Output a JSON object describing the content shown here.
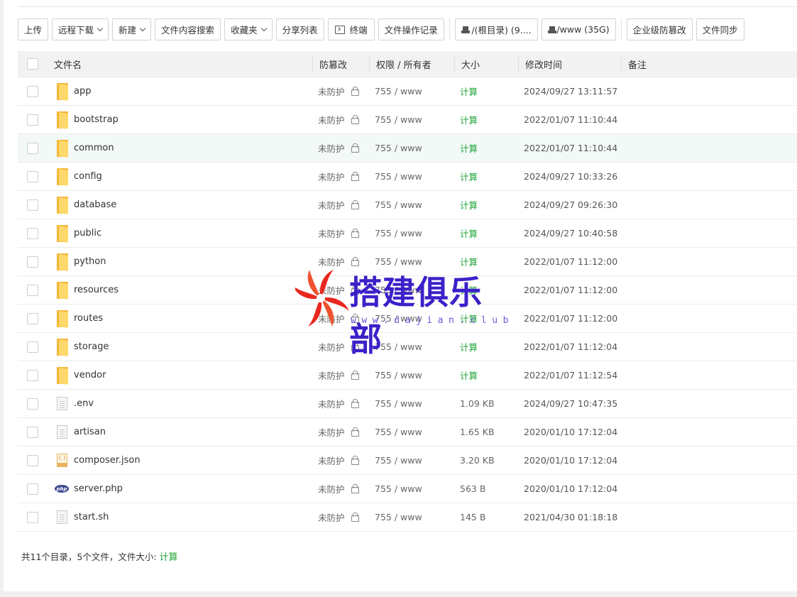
{
  "toolbar": {
    "upload": "上传",
    "remote_download": "远程下载",
    "new": "新建",
    "content_search": "文件内容搜索",
    "favorites": "收藏夹",
    "share_list": "分享列表",
    "terminal": "终端",
    "operation_log": "文件操作记录",
    "disk_root": "/(根目录) (9....",
    "disk_www": "/www (35G)",
    "enterprise_tamper": "企业级防篡改",
    "file_sync": "文件同步"
  },
  "table": {
    "headers": {
      "name": "文件名",
      "protect": "防篡改",
      "perm": "权限 / 所有者",
      "size": "大小",
      "mtime": "修改时间",
      "note": "备注"
    },
    "rows": [
      {
        "name": "app",
        "type": "folder",
        "protect": "未防护",
        "perm": "755 / www",
        "size": "计算",
        "mtime": "2024/09/27 13:11:57"
      },
      {
        "name": "bootstrap",
        "type": "folder",
        "protect": "未防护",
        "perm": "755 / www",
        "size": "计算",
        "mtime": "2022/01/07 11:10:44"
      },
      {
        "name": "common",
        "type": "folder",
        "protect": "未防护",
        "perm": "755 / www",
        "size": "计算",
        "mtime": "2022/01/07 11:10:44"
      },
      {
        "name": "config",
        "type": "folder",
        "protect": "未防护",
        "perm": "755 / www",
        "size": "计算",
        "mtime": "2024/09/27 10:33:26"
      },
      {
        "name": "database",
        "type": "folder",
        "protect": "未防护",
        "perm": "755 / www",
        "size": "计算",
        "mtime": "2024/09/27 09:26:30"
      },
      {
        "name": "public",
        "type": "folder",
        "protect": "未防护",
        "perm": "755 / www",
        "size": "计算",
        "mtime": "2024/09/27 10:40:58"
      },
      {
        "name": "python",
        "type": "folder",
        "protect": "未防护",
        "perm": "755 / www",
        "size": "计算",
        "mtime": "2022/01/07 11:12:00"
      },
      {
        "name": "resources",
        "type": "folder",
        "protect": "未防护",
        "perm": "755 / www",
        "size": "计算",
        "mtime": "2022/01/07 11:12:00"
      },
      {
        "name": "routes",
        "type": "folder",
        "protect": "未防护",
        "perm": "755 / www",
        "size": "计算",
        "mtime": "2022/01/07 11:12:00"
      },
      {
        "name": "storage",
        "type": "folder",
        "protect": "未防护",
        "perm": "755 / www",
        "size": "计算",
        "mtime": "2022/01/07 11:12:04"
      },
      {
        "name": "vendor",
        "type": "folder",
        "protect": "未防护",
        "perm": "755 / www",
        "size": "计算",
        "mtime": "2022/01/07 11:12:54"
      },
      {
        "name": ".env",
        "type": "text",
        "protect": "未防护",
        "perm": "755 / www",
        "size": "1.09 KB",
        "mtime": "2024/09/27 10:47:35"
      },
      {
        "name": "artisan",
        "type": "text",
        "protect": "未防护",
        "perm": "755 / www",
        "size": "1.65 KB",
        "mtime": "2020/01/10 17:12:04"
      },
      {
        "name": "composer.json",
        "type": "json",
        "protect": "未防护",
        "perm": "755 / www",
        "size": "3.20 KB",
        "mtime": "2020/01/10 17:12:04"
      },
      {
        "name": "server.php",
        "type": "php",
        "protect": "未防护",
        "perm": "755 / www",
        "size": "563 B",
        "mtime": "2020/01/10 17:12:04"
      },
      {
        "name": "start.sh",
        "type": "text",
        "protect": "未防护",
        "perm": "755 / www",
        "size": "145 B",
        "mtime": "2021/04/30 01:18:18"
      }
    ]
  },
  "footer": {
    "summary": "共11个目录，5个文件，文件大小: ",
    "calc": "计算"
  },
  "icons": {
    "json_glyph": "{ }",
    "php_glyph": "php"
  },
  "watermark": {
    "text": "搭建俱乐部",
    "url": "www.dajian.club"
  },
  "colors": {
    "accent_green": "#20a53a",
    "highlight_row": "#f2f9f6",
    "watermark_blue": "#3b21c9",
    "watermark_red": "#e8271e"
  }
}
